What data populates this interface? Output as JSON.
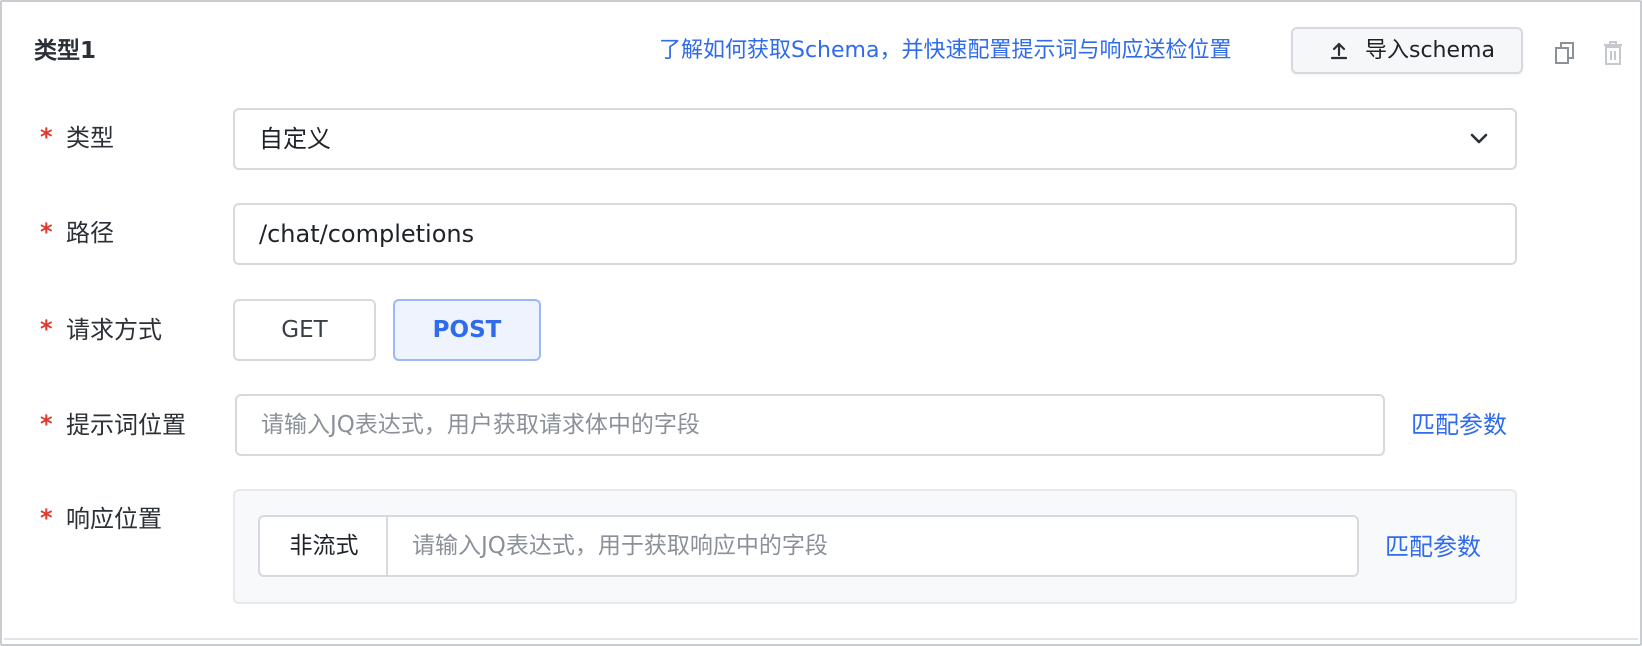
{
  "header": {
    "title": "类型1",
    "help_link": "了解如何获取Schema，并快速配置提示词与响应送检位置",
    "import_button": "导入schema"
  },
  "fields": {
    "type": {
      "required_mark": "*",
      "label": "类型",
      "value": "自定义"
    },
    "path": {
      "required_mark": "*",
      "label": "路径",
      "value": "/chat/completions"
    },
    "method": {
      "required_mark": "*",
      "label": "请求方式",
      "options": [
        "GET",
        "POST"
      ],
      "selected": "POST"
    },
    "prompt_position": {
      "required_mark": "*",
      "label": "提示词位置",
      "placeholder": "请输入JQ表达式，用户获取请求体中的字段",
      "match_link": "匹配参数"
    },
    "response_position": {
      "required_mark": "*",
      "label": "响应位置",
      "stream_mode": "非流式",
      "placeholder": "请输入JQ表达式，用于获取响应中的字段",
      "match_link": "匹配参数"
    }
  },
  "colors": {
    "accent": "#2f6bea",
    "required": "#e2372b",
    "border": "#d6d9de",
    "selected_bg": "#eef3fe"
  },
  "icons": [
    "upload-icon",
    "copy-icon",
    "trash-icon",
    "chevron-down-icon"
  ]
}
